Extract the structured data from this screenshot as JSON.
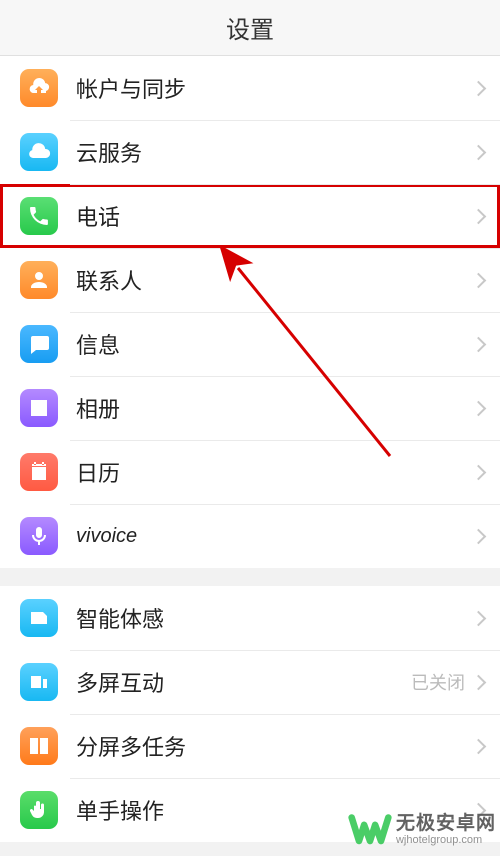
{
  "title": "设置",
  "sections": [
    {
      "rows": [
        {
          "key": "account",
          "label": "帐户与同步",
          "icon": "cloud-up-icon",
          "iconBg": "bg-orange"
        },
        {
          "key": "cloud",
          "label": "云服务",
          "icon": "cloud-icon",
          "iconBg": "bg-cyan"
        },
        {
          "key": "phone",
          "label": "电话",
          "icon": "phone-icon",
          "iconBg": "bg-green",
          "highlight": true
        },
        {
          "key": "contacts",
          "label": "联系人",
          "icon": "person-icon",
          "iconBg": "bg-orange"
        },
        {
          "key": "messages",
          "label": "信息",
          "icon": "message-icon",
          "iconBg": "bg-blue"
        },
        {
          "key": "gallery",
          "label": "相册",
          "icon": "gallery-icon",
          "iconBg": "bg-purple"
        },
        {
          "key": "calendar",
          "label": "日历",
          "icon": "calendar-icon",
          "iconBg": "bg-red"
        },
        {
          "key": "vivoice",
          "label": "vivoice",
          "icon": "mic-icon",
          "iconBg": "bg-purple",
          "labelClass": "vivoice-label"
        }
      ]
    },
    {
      "rows": [
        {
          "key": "motion",
          "label": "智能体感",
          "icon": "motion-icon",
          "iconBg": "bg-cyan"
        },
        {
          "key": "multiscreen",
          "label": "多屏互动",
          "icon": "multiscreen-icon",
          "iconBg": "bg-cyan",
          "tail": "已关闭"
        },
        {
          "key": "multitask",
          "label": "分屏多任务",
          "icon": "multitask-icon",
          "iconBg": "bg-tangerine"
        },
        {
          "key": "onehand",
          "label": "单手操作",
          "icon": "onehand-icon",
          "iconBg": "bg-green2"
        }
      ]
    }
  ],
  "watermark": {
    "title": "无极安卓网",
    "sub": "wjhotelgroup.com"
  }
}
